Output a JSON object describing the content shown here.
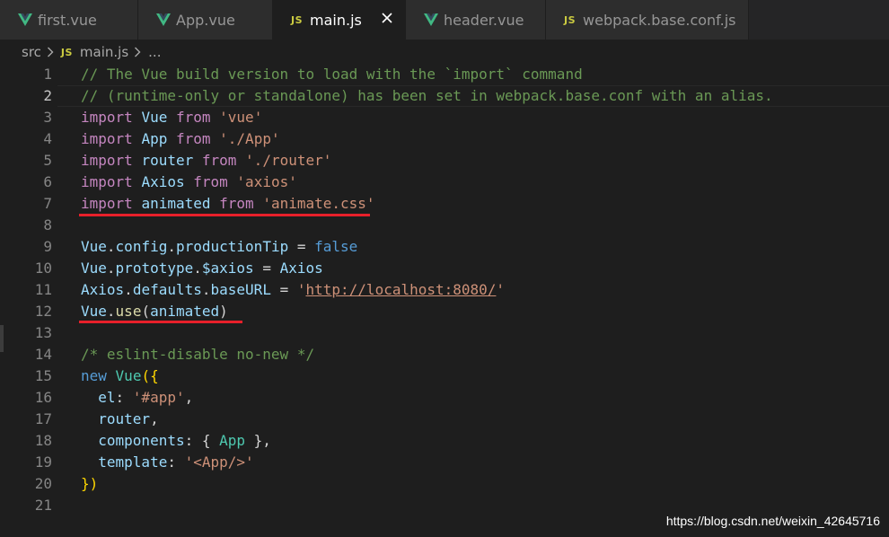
{
  "tabs": [
    {
      "label": "first.vue",
      "icon": "vue-icon",
      "active": false
    },
    {
      "label": "App.vue",
      "icon": "vue-icon",
      "active": false
    },
    {
      "label": "main.js",
      "icon": "js-icon",
      "active": true
    },
    {
      "label": "header.vue",
      "icon": "vue-icon",
      "active": false
    },
    {
      "label": "webpack.base.conf.js",
      "icon": "js-icon",
      "active": false
    }
  ],
  "js_badge": "JS",
  "breadcrumb": {
    "folder": "src",
    "file": "main.js",
    "symbol": "..."
  },
  "code": {
    "lines": [
      [
        [
          "cm",
          "// The Vue build version to load with the `import` command"
        ]
      ],
      [
        [
          "cm",
          "// (runtime-only or standalone) has been set in webpack.base.conf with an alias."
        ]
      ],
      [
        [
          "kw",
          "import"
        ],
        [
          "pn",
          " "
        ],
        [
          "id",
          "Vue"
        ],
        [
          "pn",
          " "
        ],
        [
          "kw",
          "from"
        ],
        [
          "pn",
          " "
        ],
        [
          "st",
          "'vue'"
        ]
      ],
      [
        [
          "kw",
          "import"
        ],
        [
          "pn",
          " "
        ],
        [
          "id",
          "App"
        ],
        [
          "pn",
          " "
        ],
        [
          "kw",
          "from"
        ],
        [
          "pn",
          " "
        ],
        [
          "st",
          "'./App'"
        ]
      ],
      [
        [
          "kw",
          "import"
        ],
        [
          "pn",
          " "
        ],
        [
          "id",
          "router"
        ],
        [
          "pn",
          " "
        ],
        [
          "kw",
          "from"
        ],
        [
          "pn",
          " "
        ],
        [
          "st",
          "'./router'"
        ]
      ],
      [
        [
          "kw",
          "import"
        ],
        [
          "pn",
          " "
        ],
        [
          "id",
          "Axios"
        ],
        [
          "pn",
          " "
        ],
        [
          "kw",
          "from"
        ],
        [
          "pn",
          " "
        ],
        [
          "st",
          "'axios'"
        ]
      ],
      [
        [
          "kw",
          "import"
        ],
        [
          "pn",
          " "
        ],
        [
          "id",
          "animated"
        ],
        [
          "pn",
          " "
        ],
        [
          "kw",
          "from"
        ],
        [
          "pn",
          " "
        ],
        [
          "st",
          "'animate.css'"
        ]
      ],
      [],
      [
        [
          "id",
          "Vue"
        ],
        [
          "pn",
          "."
        ],
        [
          "id",
          "config"
        ],
        [
          "pn",
          "."
        ],
        [
          "id",
          "productionTip"
        ],
        [
          "pn",
          " = "
        ],
        [
          "bl",
          "false"
        ]
      ],
      [
        [
          "id",
          "Vue"
        ],
        [
          "pn",
          "."
        ],
        [
          "id",
          "prototype"
        ],
        [
          "pn",
          "."
        ],
        [
          "id",
          "$axios"
        ],
        [
          "pn",
          " = "
        ],
        [
          "id",
          "Axios"
        ]
      ],
      [
        [
          "id",
          "Axios"
        ],
        [
          "pn",
          "."
        ],
        [
          "id",
          "defaults"
        ],
        [
          "pn",
          "."
        ],
        [
          "id",
          "baseURL"
        ],
        [
          "pn",
          " = "
        ],
        [
          "st",
          "'"
        ],
        [
          "st ul",
          "http://localhost:8080/"
        ],
        [
          "st",
          "'"
        ]
      ],
      [
        [
          "id",
          "Vue"
        ],
        [
          "pn",
          "."
        ],
        [
          "fn",
          "use"
        ],
        [
          "pn",
          "("
        ],
        [
          "id",
          "animated"
        ],
        [
          "pn",
          ")"
        ]
      ],
      [],
      [
        [
          "cm",
          "/* eslint-disable no-new */"
        ]
      ],
      [
        [
          "bl",
          "new"
        ],
        [
          "pn",
          " "
        ],
        [
          "cl",
          "Vue"
        ],
        [
          "br",
          "({"
        ]
      ],
      [
        [
          "pn",
          "  "
        ],
        [
          "id",
          "el"
        ],
        [
          "pn",
          ": "
        ],
        [
          "st",
          "'#app'"
        ],
        [
          "pn",
          ","
        ]
      ],
      [
        [
          "pn",
          "  "
        ],
        [
          "id",
          "router"
        ],
        [
          "pn",
          ","
        ]
      ],
      [
        [
          "pn",
          "  "
        ],
        [
          "id",
          "components"
        ],
        [
          "pn",
          ": { "
        ],
        [
          "cl",
          "App"
        ],
        [
          "pn",
          " },"
        ]
      ],
      [
        [
          "pn",
          "  "
        ],
        [
          "id",
          "template"
        ],
        [
          "pn",
          ": "
        ],
        [
          "st",
          "'<App/>'"
        ]
      ],
      [
        [
          "br",
          "})"
        ]
      ],
      []
    ]
  },
  "watermark": "https://blog.csdn.net/weixin_42645716",
  "colors": {
    "background": "#1e1e1e",
    "tab_inactive": "#2d2d2d",
    "comment": "#6a9955",
    "keyword": "#c586c0",
    "identifier": "#9cdcfe",
    "string": "#ce9178",
    "vue_icon": "#41b883",
    "js_icon": "#cbcb41",
    "annotation_red": "#e8202a"
  }
}
